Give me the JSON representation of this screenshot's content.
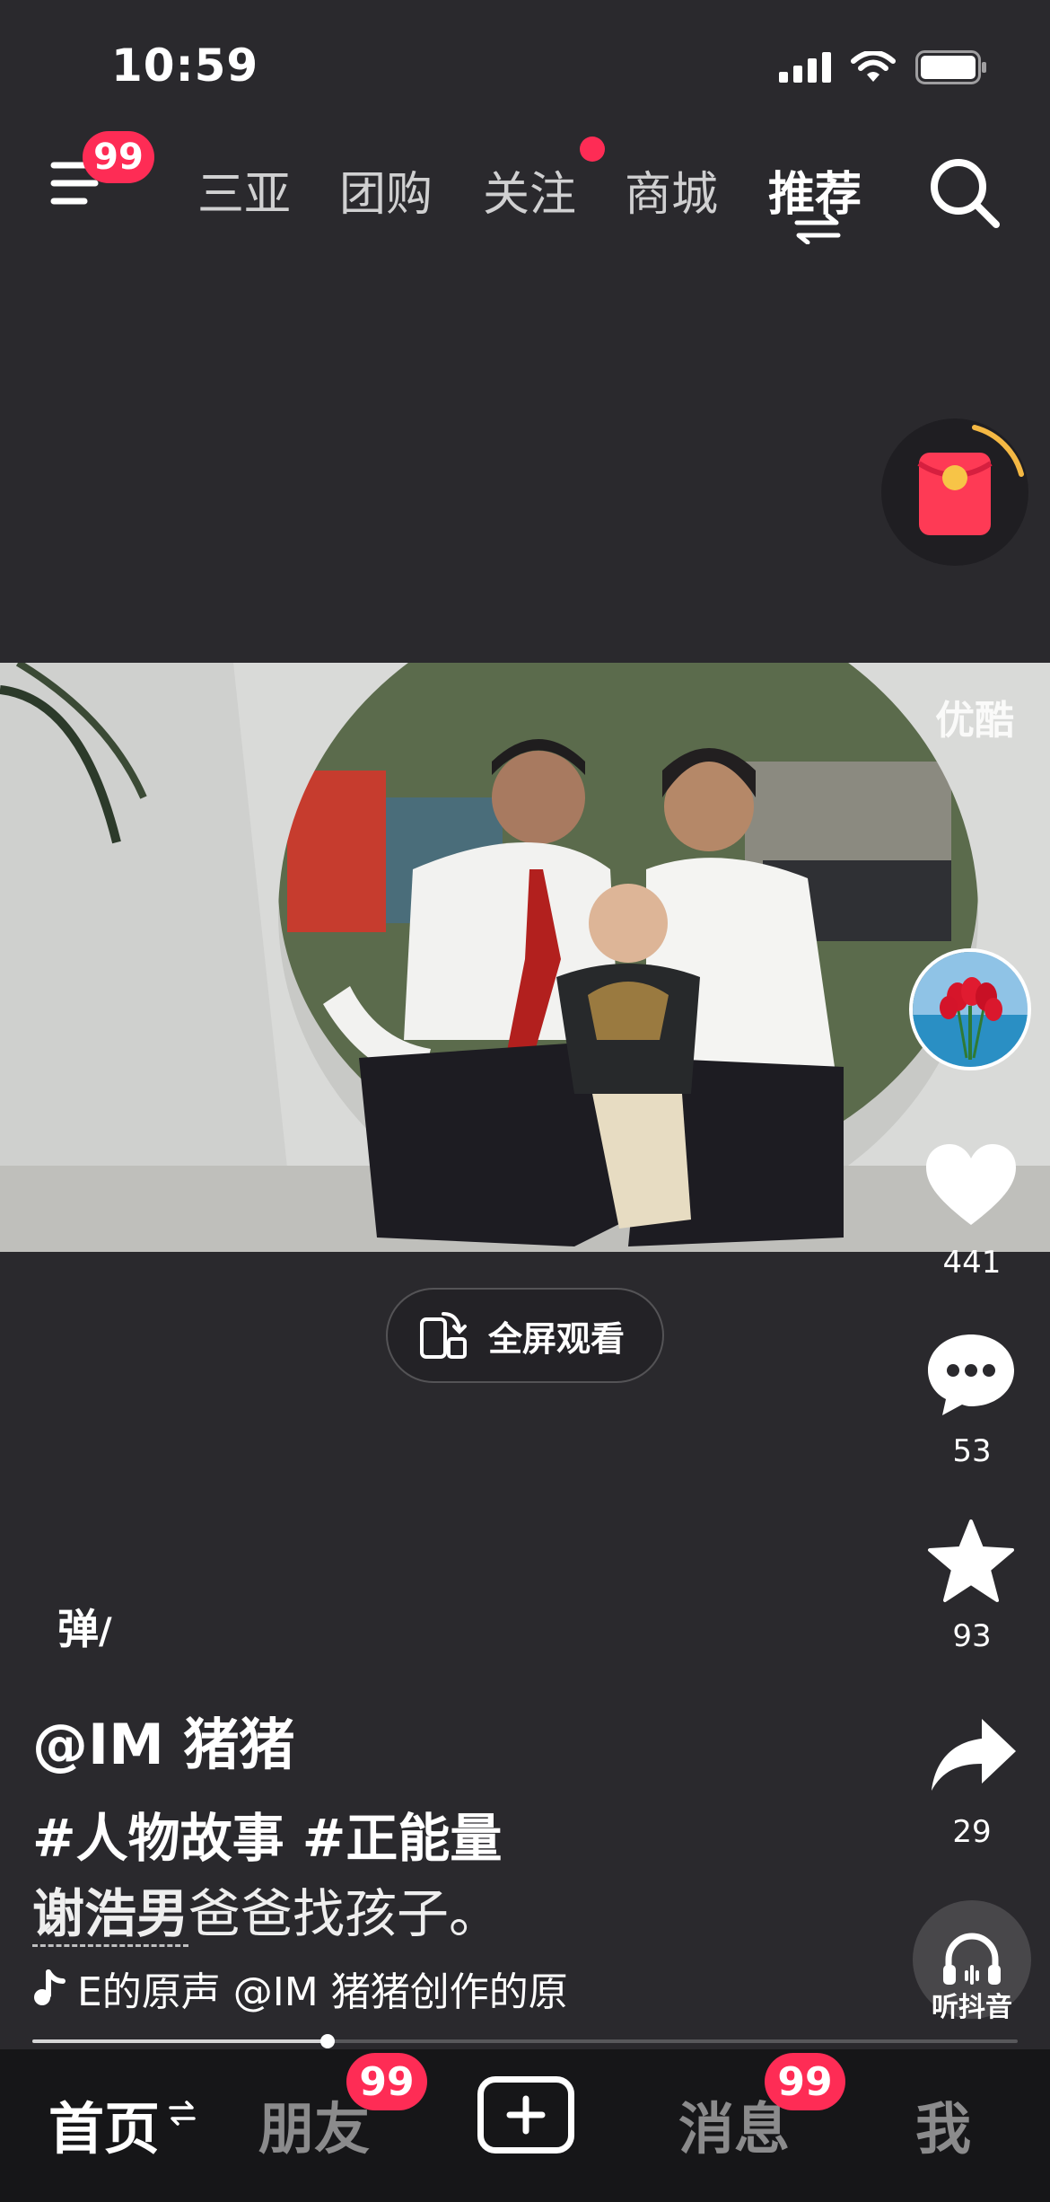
{
  "status": {
    "time": "10:59"
  },
  "topnav": {
    "menu_badge": "99",
    "tabs": [
      "三亚",
      "团购",
      "关注",
      "商城",
      "推荐"
    ]
  },
  "video": {
    "watermark": "优酷"
  },
  "fullscreen_label": "全屏观看",
  "rail": {
    "likes": "441",
    "comments": "53",
    "favorites": "93",
    "shares": "29",
    "listen_label": "听抖音"
  },
  "danmaku_label": "弹",
  "caption": {
    "author": "@IM 猪猪",
    "tags": "#人物故事 #正能量",
    "desc_highlight": "谢浩男",
    "desc_rest": "爸爸找孩子。",
    "music": "E的原声   @IM 猪猪创作的原"
  },
  "progress": 0.3,
  "bottomnav": {
    "home": "首页",
    "friends": "朋友",
    "friends_badge": "99",
    "messages": "消息",
    "messages_badge": "99",
    "me": "我"
  },
  "colors": {
    "accent": "#fe2c55",
    "background": "#2a292d",
    "tabbar": "#161618"
  }
}
